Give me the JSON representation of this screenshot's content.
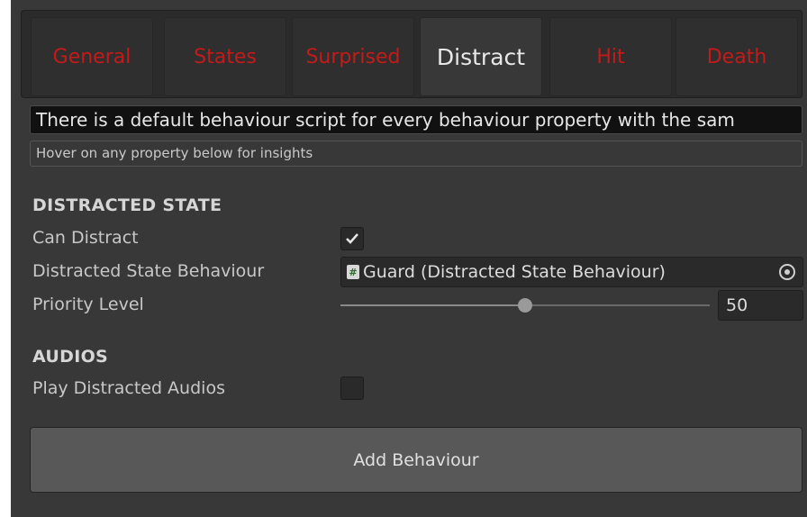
{
  "tabs": [
    {
      "label": "General",
      "active": false
    },
    {
      "label": "States",
      "active": false
    },
    {
      "label": "Surprised",
      "active": false
    },
    {
      "label": "Distract",
      "active": true
    },
    {
      "label": "Hit",
      "active": false
    },
    {
      "label": "Death",
      "active": false
    }
  ],
  "info_text": "There is a default behaviour script for every behaviour property with the sam",
  "hint_text": "Hover on any property below for insights",
  "distracted_state": {
    "section_title": "DISTRACTED STATE",
    "can_distract": {
      "label": "Can Distract",
      "checked": true
    },
    "behaviour": {
      "label": "Distracted State Behaviour",
      "value": "Guard (Distracted State Behaviour)"
    },
    "priority": {
      "label": "Priority Level",
      "value": "50",
      "slider_fraction": 0.5
    }
  },
  "audios": {
    "section_title": "AUDIOS",
    "play_distracted": {
      "label": "Play Distracted Audios",
      "checked": false
    }
  },
  "add_button_label": "Add Behaviour",
  "colors": {
    "panel_bg": "#383838",
    "inactive_tab_text": "#c41a1a",
    "active_tab_text": "#e8e8e8"
  }
}
